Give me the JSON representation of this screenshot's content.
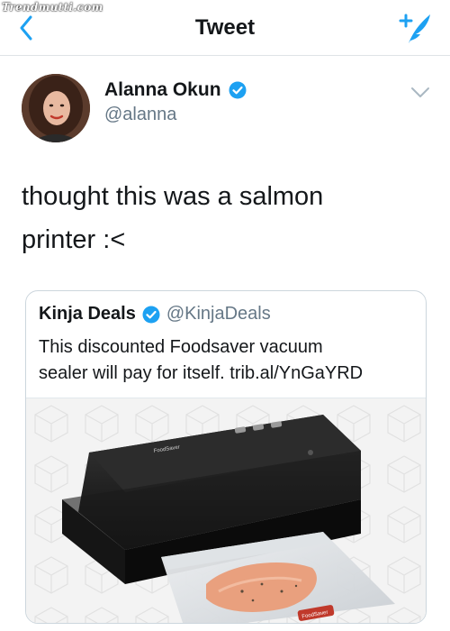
{
  "watermark": "Trendmutti.com",
  "topbar": {
    "title": "Tweet",
    "back_icon": "chevron-left-icon",
    "compose_icon": "compose-feather-icon",
    "accent": "#1da1f2"
  },
  "tweet": {
    "author_name": "Alanna Okun",
    "author_handle": "@alanna",
    "text_line1": "thought this was a salmon",
    "text_line2": "printer :<"
  },
  "quoted_tweet": {
    "author_name": "Kinja Deals",
    "author_handle": "@KinjaDeals",
    "text_line1": "This discounted Foodsaver vacuum",
    "text_line2": "sealer will pay for itself. trib.al/YnGaYRD",
    "image_label_brand": "FoodSaver"
  },
  "colors": {
    "verified": "#1da1f2",
    "secondary_text": "#657786",
    "divider": "#dfe3e7"
  }
}
